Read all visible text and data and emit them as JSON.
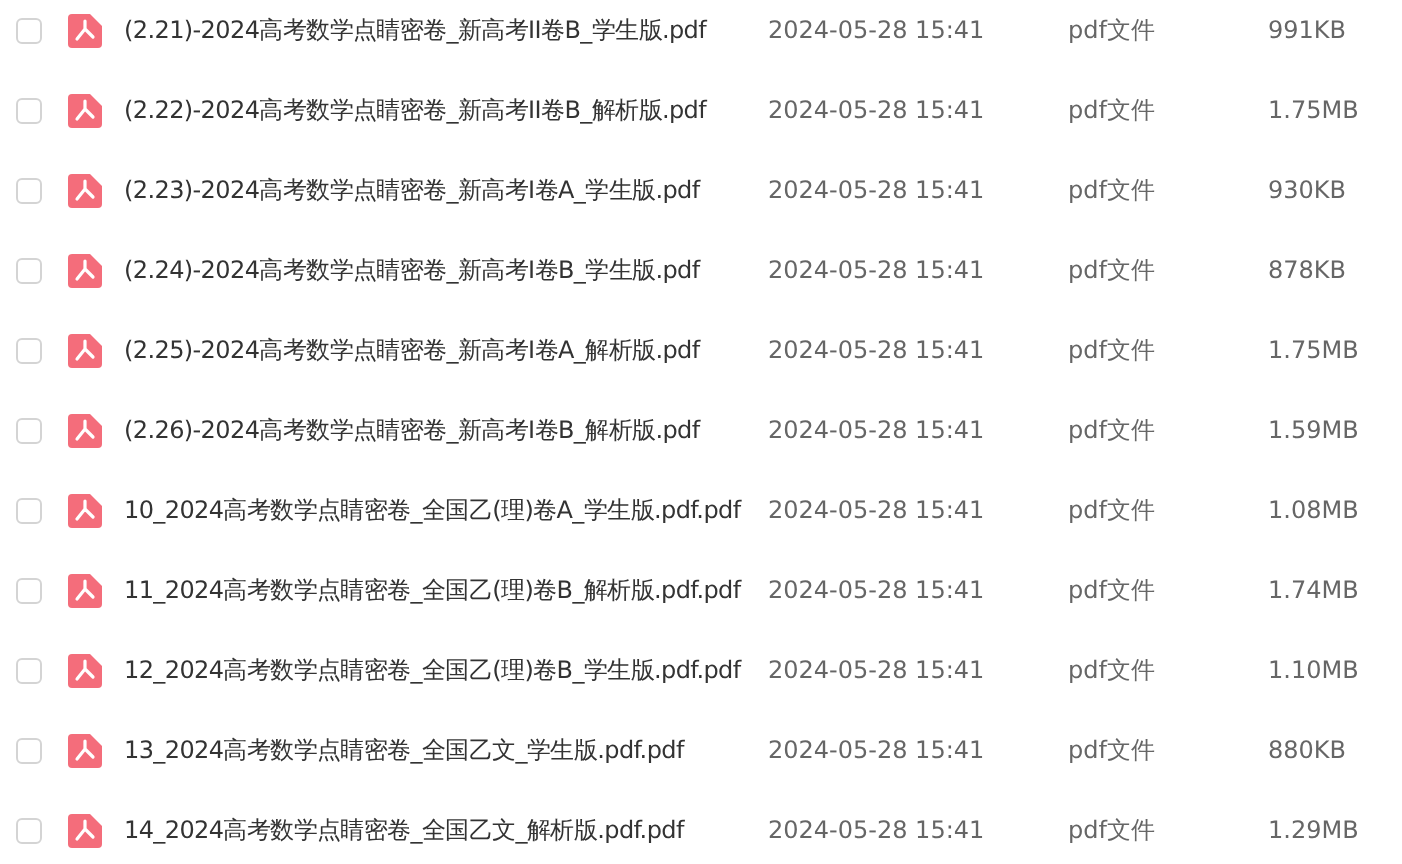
{
  "files": [
    {
      "checked": false,
      "name": "(2.21)-2024高考数学点睛密卷_新高考II卷B_学生版.pdf",
      "modified": "2024-05-28 15:41",
      "type": "pdf文件",
      "size": "991KB"
    },
    {
      "checked": false,
      "name": "(2.22)-2024高考数学点睛密卷_新高考II卷B_解析版.pdf",
      "modified": "2024-05-28 15:41",
      "type": "pdf文件",
      "size": "1.75MB"
    },
    {
      "checked": false,
      "name": "(2.23)-2024高考数学点睛密卷_新高考I卷A_学生版.pdf",
      "modified": "2024-05-28 15:41",
      "type": "pdf文件",
      "size": "930KB"
    },
    {
      "checked": false,
      "name": "(2.24)-2024高考数学点睛密卷_新高考I卷B_学生版.pdf",
      "modified": "2024-05-28 15:41",
      "type": "pdf文件",
      "size": "878KB"
    },
    {
      "checked": false,
      "name": "(2.25)-2024高考数学点睛密卷_新高考I卷A_解析版.pdf",
      "modified": "2024-05-28 15:41",
      "type": "pdf文件",
      "size": "1.75MB"
    },
    {
      "checked": false,
      "name": "(2.26)-2024高考数学点睛密卷_新高考I卷B_解析版.pdf",
      "modified": "2024-05-28 15:41",
      "type": "pdf文件",
      "size": "1.59MB"
    },
    {
      "checked": false,
      "name": "10_2024高考数学点睛密卷_全国乙(理)卷A_学生版.pdf.pdf",
      "modified": "2024-05-28 15:41",
      "type": "pdf文件",
      "size": "1.08MB"
    },
    {
      "checked": false,
      "name": "11_2024高考数学点睛密卷_全国乙(理)卷B_解析版.pdf.pdf",
      "modified": "2024-05-28 15:41",
      "type": "pdf文件",
      "size": "1.74MB"
    },
    {
      "checked": false,
      "name": "12_2024高考数学点睛密卷_全国乙(理)卷B_学生版.pdf.pdf",
      "modified": "2024-05-28 15:41",
      "type": "pdf文件",
      "size": "1.10MB"
    },
    {
      "checked": false,
      "name": "13_2024高考数学点睛密卷_全国乙文_学生版.pdf.pdf",
      "modified": "2024-05-28 15:41",
      "type": "pdf文件",
      "size": "880KB"
    },
    {
      "checked": false,
      "name": "14_2024高考数学点睛密卷_全国乙文_解析版.pdf.pdf",
      "modified": "2024-05-28 15:41",
      "type": "pdf文件",
      "size": "1.29MB"
    }
  ]
}
